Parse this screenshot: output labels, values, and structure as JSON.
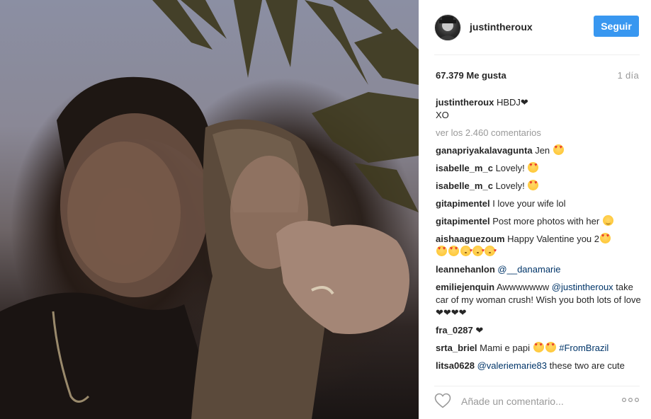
{
  "post": {
    "username": "justintheroux",
    "follow_label": "Seguir",
    "likes": "67.379 Me gusta",
    "time": "1 día",
    "caption_user": "justintheroux",
    "caption_line1": "HBDJ",
    "caption_line2": "XO",
    "view_all": "ver los 2.460 comentarios",
    "comment_placeholder": "Añade un comentario...",
    "colors": {
      "accent": "#3897f0",
      "mention": "#003569",
      "muted": "#999999"
    }
  },
  "comments": [
    {
      "user": "ganapriyakalavagunta",
      "text": "Jen"
    },
    {
      "user": "isabelle_m_c",
      "text": "Lovely!"
    },
    {
      "user": "isabelle_m_c",
      "text": "Lovely!"
    },
    {
      "user": "gitapimentel",
      "text": "I love your wife lol"
    },
    {
      "user": "gitapimentel",
      "text": "Post more photos with her"
    },
    {
      "user": "aishaaguezoum",
      "text": "Happy Valentine you 2"
    },
    {
      "user": "leannehanlon",
      "mention": "@__danamarie"
    },
    {
      "user": "emiliejenquin",
      "text_before": "Awwwwwww",
      "mention": "@justintheroux",
      "text_after": "take car of my woman crush! Wish you both lots of love"
    },
    {
      "user": "fra_0287"
    },
    {
      "user": "srta_briel",
      "text": "Mami e papi",
      "tag": "#FromBrazil"
    },
    {
      "user": "litsa0628",
      "mention": "@valeriemarie83",
      "text": "these two are cute"
    }
  ],
  "icons": {
    "heart": "heart-outline-icon",
    "more": "ellipsis-icon"
  }
}
